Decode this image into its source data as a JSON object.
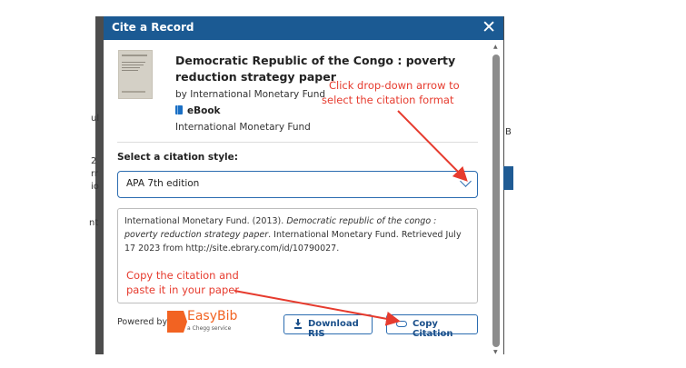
{
  "dialog": {
    "title": "Cite a Record",
    "close_icon": "close-icon"
  },
  "record": {
    "title": "Democratic Republic of the Congo : poverty reduction strategy paper",
    "author": "by International Monetary Fund",
    "type": "eBook",
    "publisher": "International Monetary Fund"
  },
  "citation_style": {
    "label": "Select a citation style:",
    "selected": "APA 7th edition"
  },
  "citation": {
    "part1": "International Monetary Fund. (2013). ",
    "title": "Democratic republic of the congo : poverty reduction strategy paper",
    "part2": ". International Monetary Fund. Retrieved July 17 2023 from http://site.ebrary.com/id/10790027."
  },
  "footer": {
    "powered_by": "Powered by",
    "brand_name": "EasyBib",
    "brand_tagline": "a Chegg service",
    "download_label": "Download RIS",
    "copy_label": "Copy Citation"
  },
  "annotations": {
    "dropdown_hint_line1": "Click drop-down arrow to",
    "dropdown_hint_line2": "select the citation format",
    "copy_hint_line1": "Copy the citation and",
    "copy_hint_line2": "paste it in your paper"
  },
  "colors": {
    "header": "#1b5a93",
    "accent": "#2b6cb0",
    "annotation": "#e63b2e",
    "brand": "#f26322"
  },
  "background": {
    "left_fragments": [
      "ul",
      "2",
      "rr",
      "io",
      "nt"
    ],
    "right_fragment": "B"
  }
}
